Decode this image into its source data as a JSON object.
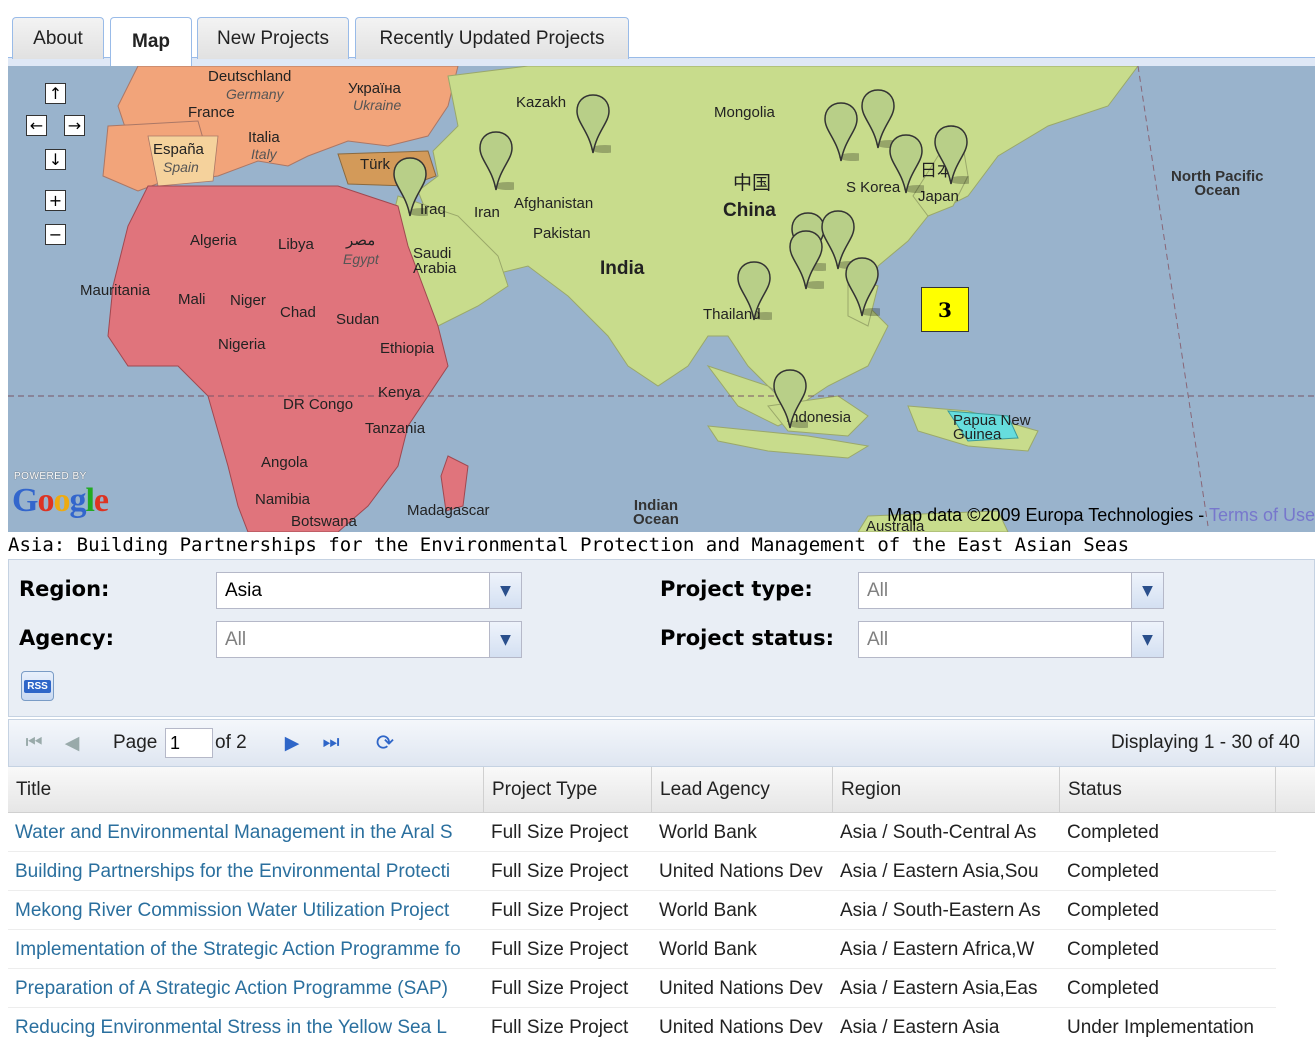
{
  "tabs": [
    {
      "label": "About",
      "active": false
    },
    {
      "label": "Map",
      "active": true
    },
    {
      "label": "New Projects",
      "active": false
    },
    {
      "label": "Recently Updated Projects",
      "active": false
    }
  ],
  "map": {
    "labels": {
      "deutschland": "Deutschland",
      "germany": "Germany",
      "ukraina": "Україна",
      "ukraine": "Ukraine",
      "france": "France",
      "italia": "Italia",
      "italy": "Italy",
      "espana": "España",
      "spain": "Spain",
      "turkiye": "Türk",
      "iraq": "Iraq",
      "iran": "Iran",
      "kazakh": "Kazakh",
      "mongolia": "Mongolia",
      "china_cn": "中国",
      "china": "China",
      "afghanistan": "Afghanistan",
      "pakistan": "Pakistan",
      "india": "India",
      "korea": "S Korea",
      "japan_cn": "日本",
      "japan": "Japan",
      "north_pacific": "North Pacific\nOcean",
      "algeria": "Algeria",
      "libya": "Libya",
      "egypt_ar": "مصر",
      "egypt": "Egypt",
      "saudi": "Saudi\nArabia",
      "mauritania": "Mauritania",
      "mali": "Mali",
      "niger": "Niger",
      "chad": "Chad",
      "sudan": "Sudan",
      "nigeria": "Nigeria",
      "ethiopia": "Ethiopia",
      "kenya": "Kenya",
      "drcongo": "DR Congo",
      "tanzania": "Tanzania",
      "angola": "Angola",
      "namibia": "Namibia",
      "botswana": "Botswana",
      "madagascar": "Madagascar",
      "indian_ocean": "Indian\nOcean",
      "thailand": "Thailand",
      "indonesia": "Indonesia",
      "papua": "Papua New\nGuinea",
      "australia": "Australia"
    },
    "cluster_count": "3",
    "powered_by": "POWERED BY",
    "google_logo": "Google",
    "attribution": "Map data ©2009 Europa Technologies - ",
    "terms_link": "Terms of Use",
    "colors": {
      "water": "#99b3cc",
      "asia": "#c8dc8c",
      "africa": "#e0747c",
      "europe": "#f2a47a",
      "turkey": "#d39a59"
    }
  },
  "selected_title": "Asia: Building Partnerships for the Environmental Protection and Management of the East Asian Seas",
  "filters": {
    "region_label": "Region:",
    "region_value": "Asia",
    "agency_label": "Agency:",
    "agency_value": "All",
    "type_label": "Project type:",
    "type_value": "All",
    "status_label": "Project status:",
    "status_value": "All",
    "rss_label": "RSS"
  },
  "pager": {
    "page_label": "Page",
    "page_value": "1",
    "of_label": "of 2",
    "displaying": "Displaying 1 - 30 of 40"
  },
  "grid": {
    "columns": [
      "Title",
      "Project Type",
      "Lead Agency",
      "Region",
      "Status"
    ],
    "rows": [
      [
        "Water and Environmental Management in the Aral S",
        "Full Size Project",
        "World Bank",
        "Asia / South-Central As",
        "Completed"
      ],
      [
        "Building Partnerships for the Environmental Protecti",
        "Full Size Project",
        "United Nations Dev",
        "Asia / Eastern Asia,Sou",
        "Completed"
      ],
      [
        "Mekong River Commission Water Utilization Project",
        "Full Size Project",
        "World Bank",
        "Asia / South-Eastern As",
        "Completed"
      ],
      [
        "Implementation of the Strategic Action Programme fo",
        "Full Size Project",
        "World Bank",
        "Asia / Eastern Africa,W",
        "Completed"
      ],
      [
        "Preparation of A Strategic Action Programme (SAP)",
        "Full Size Project",
        "United Nations Dev",
        "Asia / Eastern Asia,Eas",
        "Completed"
      ],
      [
        "Reducing Environmental Stress in the Yellow Sea L",
        "Full Size Project",
        "United Nations Dev",
        "Asia / Eastern Asia",
        "Under Implementation"
      ]
    ]
  }
}
